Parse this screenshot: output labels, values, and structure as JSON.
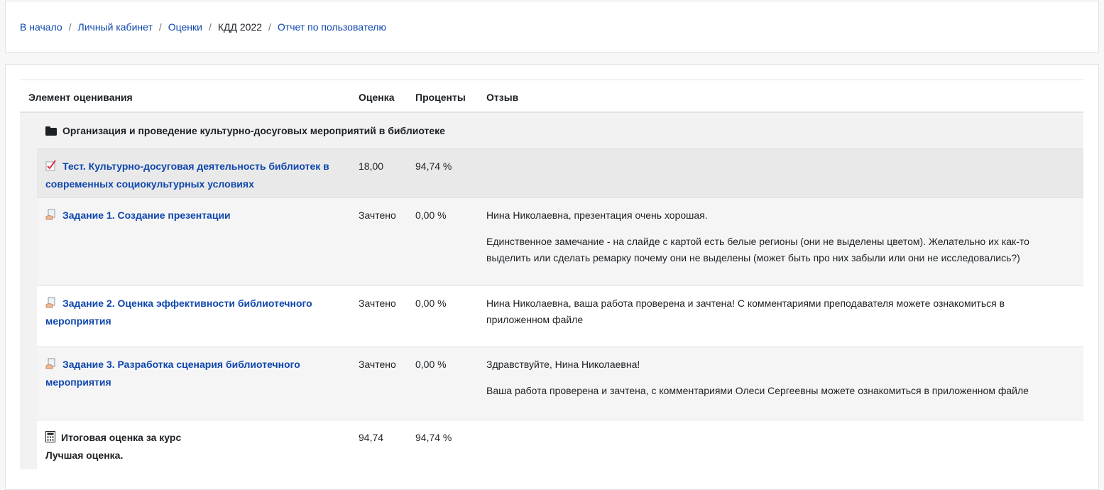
{
  "breadcrumb": [
    {
      "label": "В начало",
      "link": true
    },
    {
      "label": "Личный кабинет",
      "link": true
    },
    {
      "label": "Оценки",
      "link": true
    },
    {
      "label": "КДД 2022",
      "link": false
    },
    {
      "label": "Отчет по пользователю",
      "link": true
    }
  ],
  "table": {
    "headers": {
      "item": "Элемент оценивания",
      "grade": "Оценка",
      "percent": "Проценты",
      "feedback": "Отзыв"
    },
    "category": {
      "icon": "folder-icon",
      "title": "Организация и проведение культурно-досуговых мероприятий в библиотеке"
    },
    "rows": [
      {
        "icon": "quiz-icon",
        "title_line1": "Тест. Культурно-досуговая деятельность библиотек в",
        "title_line2": "современных социокультурных условиях",
        "grade": "18,00",
        "percent": "94,74 %",
        "feedback": []
      },
      {
        "icon": "assignment-icon",
        "title_line1": "Задание 1. Создание презентации",
        "title_line2": "",
        "grade": "Зачтено",
        "percent": "0,00 %",
        "feedback": [
          "Нина Николаевна, презентация очень хорошая.",
          "Единственное замечание - на слайде с картой есть белые регионы (они не выделены цветом). Желательно их как-то выделить или сделать ремарку почему они не выделены (может быть про них забыли или они не исследовались?)"
        ]
      },
      {
        "icon": "assignment-icon",
        "title_line1": "Задание 2. Оценка эффективности библиотечного",
        "title_line2": "мероприятия",
        "grade": "Зачтено",
        "percent": "0,00 %",
        "feedback": [
          "Нина Николаевна, ваша работа проверена и зачтена! С комментариями преподавателя можете ознакомиться в приложенном файле"
        ]
      },
      {
        "icon": "assignment-icon",
        "title_line1": "Задание 3. Разработка сценария библиотечного",
        "title_line2": "мероприятия",
        "grade": "Зачтено",
        "percent": "0,00 %",
        "feedback": [
          "Здравствуйте, Нина Николаевна!",
          "Ваша работа проверена и зачтена, с комментариями Олеси Сергеевны можете ознакомиться в приложенном файле"
        ]
      }
    ],
    "total": {
      "icon": "calculator-icon",
      "title": "Итоговая оценка за курс",
      "subtitle": "Лучшая оценка.",
      "grade": "94,74",
      "percent": "94,74 %"
    }
  }
}
